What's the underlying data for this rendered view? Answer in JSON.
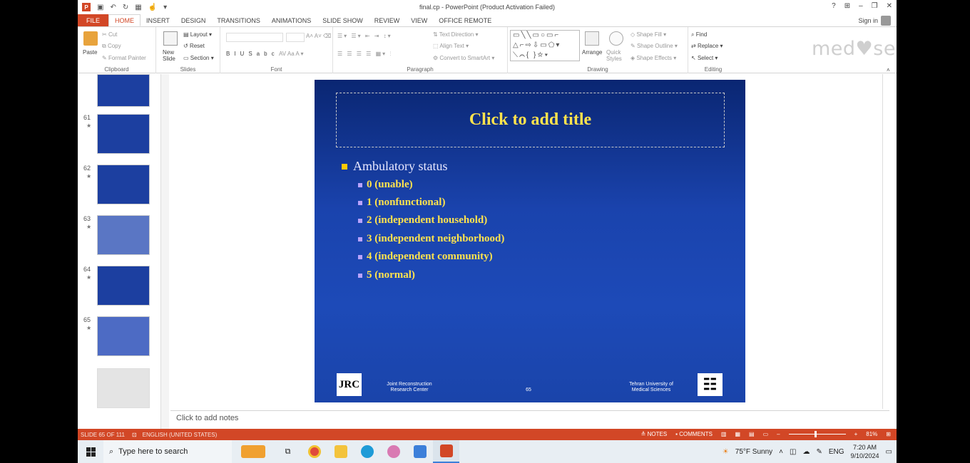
{
  "window": {
    "title": "final.cp - PowerPoint (Product Activation Failed)",
    "controls": [
      "?",
      "⊞",
      "–",
      "❐",
      "✕"
    ],
    "sign_in": "Sign in"
  },
  "ribbon_tabs": [
    "FILE",
    "HOME",
    "INSERT",
    "DESIGN",
    "TRANSITIONS",
    "ANIMATIONS",
    "SLIDE SHOW",
    "REVIEW",
    "VIEW",
    "OFFICE REMOTE"
  ],
  "active_tab": "HOME",
  "ribbon": {
    "clipboard": {
      "label": "Clipboard",
      "paste": "Paste",
      "cut": "Cut",
      "copy": "Copy",
      "format_painter": "Format Painter"
    },
    "slides": {
      "label": "Slides",
      "new_slide": "New Slide",
      "layout": "Layout",
      "reset": "Reset",
      "section": "Section"
    },
    "font": {
      "label": "Font"
    },
    "paragraph": {
      "label": "Paragraph",
      "text_direction": "Text Direction",
      "align_text": "Align Text",
      "smartart": "Convert to SmartArt"
    },
    "drawing": {
      "label": "Drawing",
      "arrange": "Arrange",
      "quick_styles": "Quick Styles",
      "shape_fill": "Shape Fill",
      "shape_outline": "Shape Outline",
      "shape_effects": "Shape Effects"
    },
    "editing": {
      "label": "Editing",
      "find": "Find",
      "replace": "Replace",
      "select": "Select"
    }
  },
  "watermark": "med♥seen",
  "thumbnails": [
    {
      "num": "",
      "style": "dark"
    },
    {
      "num": "61",
      "style": "dark"
    },
    {
      "num": "62",
      "style": "dark"
    },
    {
      "num": "63",
      "style": "light"
    },
    {
      "num": "64",
      "style": "dark"
    },
    {
      "num": "65",
      "style": "plain"
    },
    {
      "num": "",
      "style": "blank"
    }
  ],
  "slide": {
    "title_placeholder": "Click to add title",
    "bullet": "Ambulatory status",
    "sub_bullets": [
      "0 (unable)",
      "1 (nonfunctional)",
      "2 (independent household)",
      "3 (independent neighborhood)",
      "4 (independent community)",
      "5 (normal)"
    ],
    "footer_left": "Joint Reconstruction Research Center",
    "footer_page": "65",
    "footer_right": "Tehran University of Medical Sciences",
    "logo_left": "JRC",
    "logo_right": "☷"
  },
  "notes_placeholder": "Click to add notes",
  "statusbar": {
    "slide_info": "SLIDE 65 OF 111",
    "language": "ENGLISH (UNITED STATES)",
    "notes": "NOTES",
    "comments": "COMMENTS",
    "zoom": "81%"
  },
  "taskbar": {
    "search_placeholder": "Type here to search",
    "weather": "75°F  Sunny",
    "lang": "ENG",
    "time": "7:20 AM",
    "date": "9/10/2024"
  }
}
